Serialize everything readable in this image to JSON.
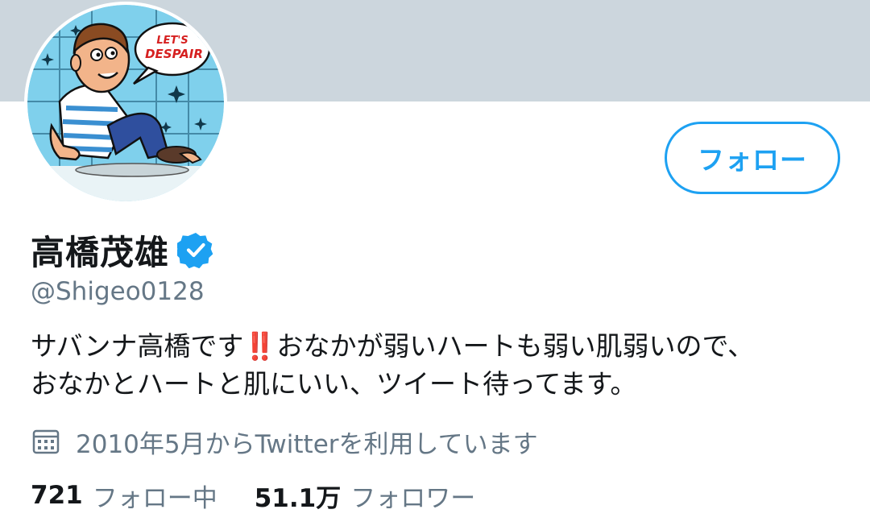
{
  "profile": {
    "display_name": "高橋茂雄",
    "handle": "@Shigeo0128",
    "verified": true,
    "avatar_speech_text_1": "LET'S",
    "avatar_speech_text_2": "DESPAIR"
  },
  "actions": {
    "follow_label": "フォロー"
  },
  "bio": {
    "line1_before_emoji": "サバンナ高橋です",
    "emoji": "‼️",
    "line1_after_emoji": "おなかが弱いハートも弱い肌弱いので、",
    "line2": "おなかとハートと肌にいい、ツイート待ってます。"
  },
  "joined": {
    "icon": "calendar-icon",
    "text": "2010年5月からTwitterを利用しています"
  },
  "stats": {
    "following_count": "721",
    "following_label": "フォロー中",
    "followers_count": "51.1万",
    "followers_label": "フォロワー"
  },
  "colors": {
    "banner": "#ccd6dd",
    "accent": "#1da1f2",
    "text_primary": "#14171a",
    "text_secondary": "#657786",
    "emoji_red": "#e0245e"
  }
}
